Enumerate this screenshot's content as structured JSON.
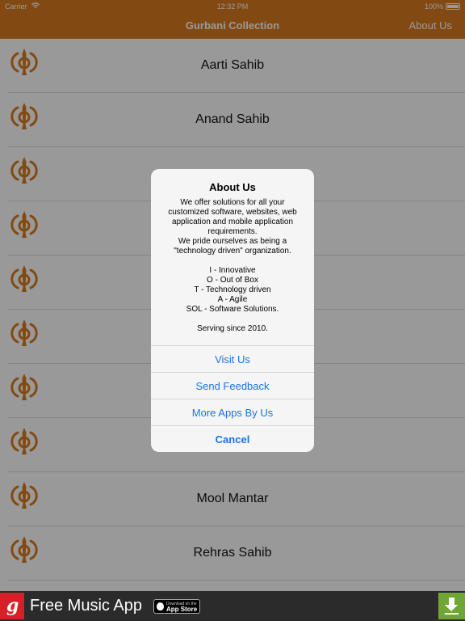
{
  "status_bar": {
    "carrier": "Carrier",
    "time": "12:32 PM",
    "battery": "100%"
  },
  "nav": {
    "title": "Gurbani Collection",
    "about_button": "About Us"
  },
  "list": {
    "items": [
      {
        "label": "Aarti Sahib",
        "icon": "khanda-icon"
      },
      {
        "label": "Anand Sahib",
        "icon": "khanda-icon"
      },
      {
        "label": "",
        "icon": "khanda-icon"
      },
      {
        "label": "",
        "icon": "khanda-icon"
      },
      {
        "label": "",
        "icon": "khanda-icon"
      },
      {
        "label": "",
        "icon": "khanda-icon"
      },
      {
        "label": "",
        "icon": "khanda-icon"
      },
      {
        "label": "",
        "icon": "khanda-icon"
      },
      {
        "label": "Mool Mantar",
        "icon": "khanda-icon"
      },
      {
        "label": "Rehras Sahib",
        "icon": "khanda-icon"
      }
    ]
  },
  "alert": {
    "title": "About Us",
    "message_lines": [
      "We offer solutions for all your",
      "customized software, websites, web",
      "application and mobile application",
      "requirements.",
      "We pride ourselves as being a",
      "\"technology driven\" organization.",
      "",
      "I - Innovative",
      "O - Out of Box",
      "T - Technology driven",
      "A - Agile",
      "SOL - Software Solutions.",
      "",
      "Serving since 2010."
    ],
    "buttons": [
      {
        "label": "Visit Us"
      },
      {
        "label": "Send Feedback"
      },
      {
        "label": "More Apps By Us"
      },
      {
        "label": "Cancel"
      }
    ]
  },
  "ad": {
    "logo_letter": "g",
    "text": "Free Music App",
    "store_small": "Download on the",
    "store_big": "App Store"
  },
  "colors": {
    "brand_orange": "#d97c1e",
    "link_blue": "#1a73e8",
    "ad_background": "#2b2b2b",
    "download_green": "#6fa634"
  }
}
